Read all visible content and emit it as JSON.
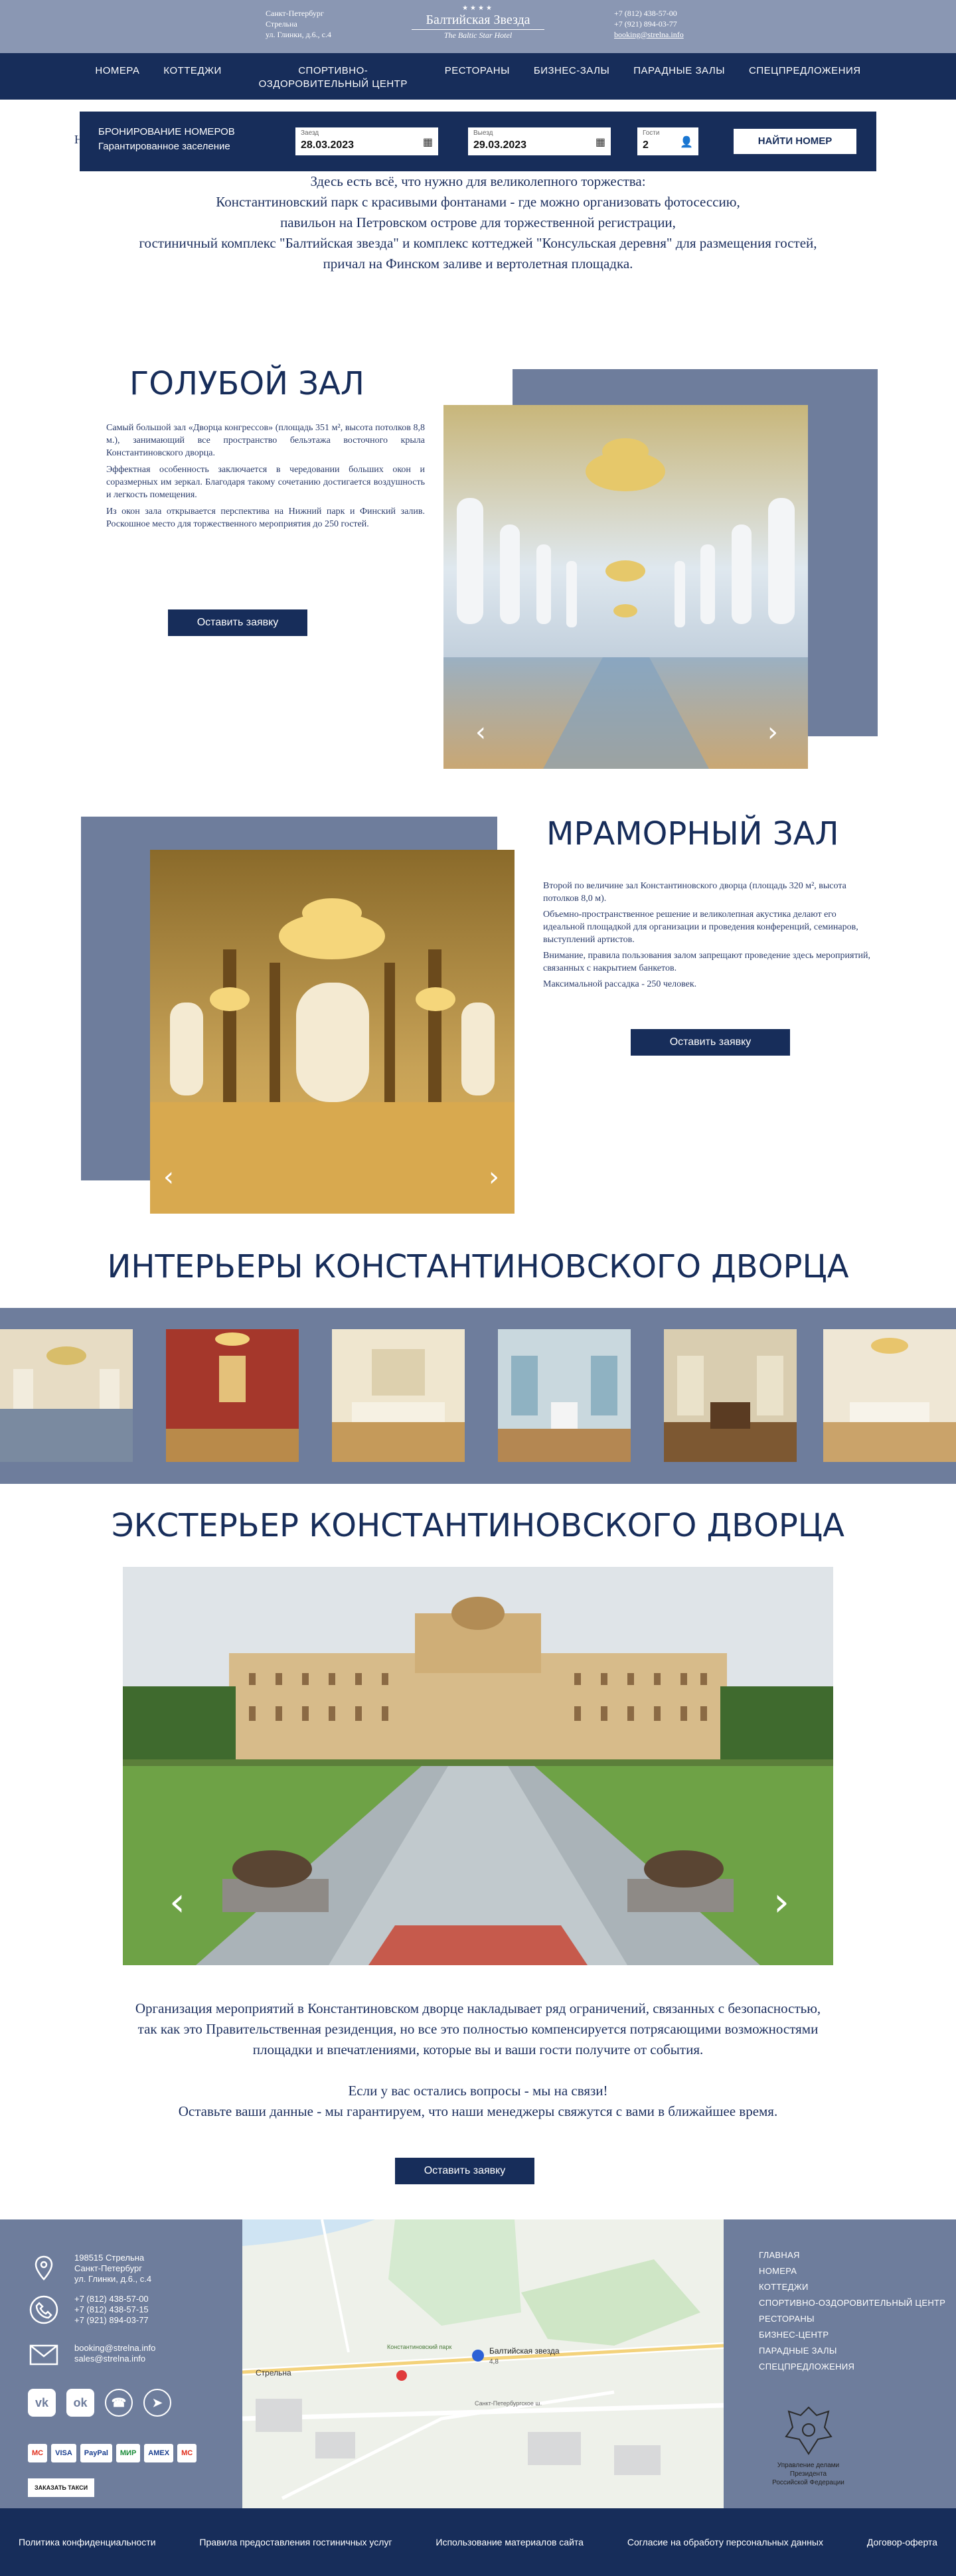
{
  "header": {
    "address": [
      "Санкт-Петербург",
      "Стрельна",
      "ул. Глинки, д.6., с.4"
    ],
    "logo_name": "Балтийская Звезда",
    "logo_sub": "The Baltic Star Hotel",
    "phones": [
      "+7 (812) 438-57-00",
      "+7 (921) 894-03-77"
    ],
    "email": "booking@strelna.info"
  },
  "nav": [
    "НОМЕРА",
    "КОТТЕДЖИ",
    "СПОРТИВНО-ОЗДОРОВИТЕЛЬНЫЙ ЦЕНТР",
    "РЕСТОРАНЫ",
    "БИЗНЕС-ЗАЛЫ",
    "ПАРАДНЫЕ ЗАЛЫ",
    "СПЕЦПРЕДЛОЖЕНИЯ"
  ],
  "booking": {
    "title1": "БРОНИРОВАНИЕ НОМЕРОВ",
    "title2": "Гарантированное заселение",
    "checkin_label": "Заезд",
    "checkin_value": "28.03.2023",
    "checkout_label": "Выезд",
    "checkout_value": "29.03.2023",
    "guests_label": "Гости",
    "guests_value": "2",
    "button": "НАЙТИ НОМЕР"
  },
  "intro": {
    "cut_letter": "Н",
    "lines": [
      "Здесь есть всё, что нужно для великолепного торжества:",
      "Константиновский парк с красивыми фонтанами - где можно организовать фотосессию,",
      "павильон на Петровском острове для торжественной регистрации,",
      "гостиничный комплекс \"Балтийская звезда\" и комплекс коттеджей \"Консульская деревня\" для размещения гостей,",
      "причал на Финском заливе и вертолетная площадка."
    ]
  },
  "blue_hall": {
    "title": "ГОЛУБОЙ ЗАЛ",
    "paragraphs": [
      "Самый большой зал «Дворца конгрессов» (площадь 351 м², высота потолков 8,8 м.), занимающий все пространство бельэтажа восточного крыла Константиновского дворца.",
      "Эффектная особенность заключается в чередовании больших окон и соразмерных им зеркал. Благодаря такому сочетанию достигается воздушность и легкость помещения.",
      "Из окон зала открывается перспектива на Нижний парк и Финский залив. Роскошное место для торжественного мероприятия до 250 гостей."
    ],
    "button": "Оставить заявку"
  },
  "marble_hall": {
    "title": "МРАМОРНЫЙ ЗАЛ",
    "paragraphs": [
      "Второй по величине зал Константиновского дворца (площадь 320 м², высота потолков 8,0 м).",
      "Объемно-пространственное решение и великолепная акустика делают его идеальной площадкой для организации и проведения конференций, семинаров, выступлений артистов.",
      "Внимание, правила пользования залом запрещают проведение здесь мероприятий, связанных с накрытием банкетов.",
      "Максимальной рассадка - 250 человек."
    ],
    "button": "Оставить заявку"
  },
  "interiors_title": "ИНТЕРЬЕРЫ КОНСТАНТИНОВСКОГО ДВОРЦА",
  "exterior_title": "ЭКСТЕРЬЕР КОНСТАНТИНОВСКОГО ДВОРЦА",
  "closing": {
    "lines1": [
      "Организация мероприятий в Константиновском дворце накладывает ряд ограничений, связанных с безопасностью,",
      "так как это Правительственная резиденция, но все это полностью компенсируется потрясающими возможностями",
      "площадки и впечатлениями, которые вы и ваши гости получите от события."
    ],
    "lines2": [
      "Если у вас остались вопросы - мы на связи!",
      "Оставьте ваши данные - мы гарантируем, что наши менеджеры свяжутся с вами в ближайшее время."
    ],
    "button": "Оставить заявку"
  },
  "footer": {
    "address": [
      "198515 Стрельна",
      "Санкт-Петербург",
      "ул. Глинки, д.6., с.4"
    ],
    "phones": [
      "+7 (812) 438-57-00",
      "+7 (812) 438-57-15",
      "+7 (921) 894-03-77"
    ],
    "emails": [
      "booking@strelna.info",
      "sales@strelna.info"
    ],
    "payments": [
      "MC",
      "VISA",
      "PayPal",
      "МИР",
      "AMEX",
      "MC"
    ],
    "taxi": "ЗАКАЗАТЬ ТАКСИ",
    "map_labels": {
      "hotel": "Балтийская звезда",
      "rating": "4,8",
      "town": "Стрельна",
      "park": "Константиновский парк",
      "road": "Санкт-Петербургское ш."
    },
    "nav": [
      "ГЛАВНАЯ",
      "НОМЕРА",
      "КОТТЕДЖИ",
      "СПОРТИВНО-ОЗДОРОВИТЕЛЬНЫЙ ЦЕНТР",
      "РЕСТОРАНЫ",
      "БИЗНЕС-ЦЕНТР",
      "ПАРАДНЫЕ ЗАЛЫ",
      "СПЕЦПРЕДЛОЖЕНИЯ"
    ],
    "emblem": [
      "Управление делами",
      "Президента",
      "Российской Федерации"
    ]
  },
  "bottom_links": [
    "Политика конфиденциальности",
    "Правила предоставления гостиничных услуг",
    "Использование материалов сайта",
    "Согласие на обработу персональных данных",
    "Договор-оферта"
  ]
}
